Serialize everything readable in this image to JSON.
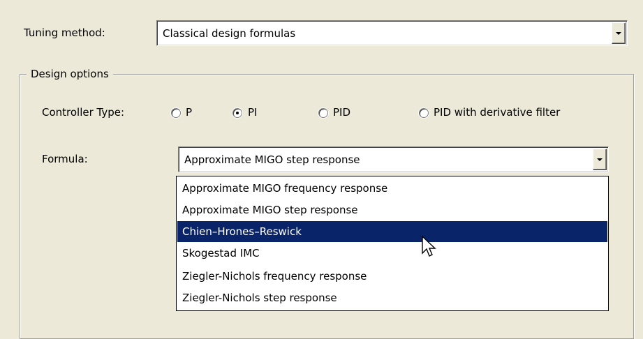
{
  "tuning": {
    "label": "Tuning method:",
    "value": "Classical design formulas"
  },
  "design_options": {
    "legend": "Design options",
    "controller_type": {
      "label": "Controller Type:",
      "options": [
        {
          "label": "P",
          "selected": false
        },
        {
          "label": "PI",
          "selected": true
        },
        {
          "label": "PID",
          "selected": false
        },
        {
          "label": "PID with derivative filter",
          "selected": false
        }
      ]
    },
    "formula": {
      "label": "Formula:",
      "value": "Approximate MIGO step response",
      "options": [
        "Approximate MIGO frequency response",
        "Approximate MIGO step response",
        "Chien–Hrones–Reswick",
        "Skogestad IMC",
        "Ziegler-Nichols frequency response",
        "Ziegler-Nichols step response"
      ],
      "highlighted_option": "Chien–Hrones–Reswick"
    }
  },
  "colors": {
    "highlight": "#0a246a",
    "background": "#ece9d8"
  },
  "icons": {
    "dropdown": "chevron-down-icon",
    "cursor": "mouse-pointer-icon"
  }
}
